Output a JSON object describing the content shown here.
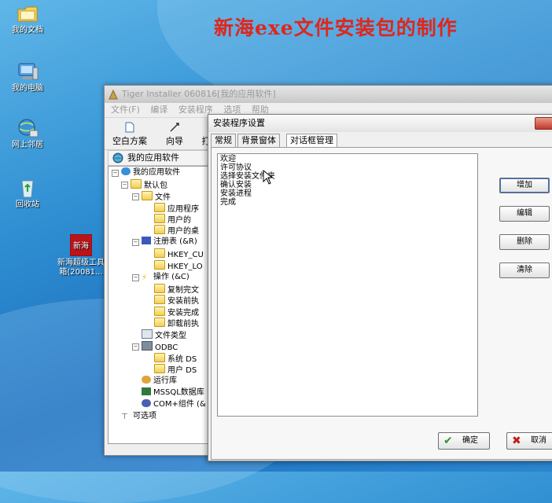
{
  "banner": {
    "title": "新海exe文件安装包的制作"
  },
  "desktop": {
    "icons": [
      {
        "label": "我的文档"
      },
      {
        "label": "我的电脑"
      },
      {
        "label": "网上邻居"
      },
      {
        "label": "回收站"
      },
      {
        "label_line1": "新海超级工具",
        "label_line2": "箱(20081..."
      }
    ]
  },
  "app": {
    "title": "Tiger Installer  060816[我的应用软件]",
    "menu": [
      "文件(F)",
      "编译",
      "安装程序",
      "选项",
      "帮助"
    ],
    "toolbar": [
      "空白方案",
      "向导",
      "打"
    ],
    "panel_title": "我的应用软件",
    "tree": [
      {
        "label": "我的应用软件"
      },
      {
        "label": "默认包"
      },
      {
        "label": "文件"
      },
      {
        "label": "应用程序"
      },
      {
        "label": "用户的 "
      },
      {
        "label": "用户的桌"
      },
      {
        "label": "注册表 (&R)"
      },
      {
        "label": "HKEY_CU"
      },
      {
        "label": "HKEY_LO"
      },
      {
        "label": "操作 (&C)"
      },
      {
        "label": "复制完文"
      },
      {
        "label": "安装前执"
      },
      {
        "label": "安装完成"
      },
      {
        "label": "卸载前执"
      },
      {
        "label": "文件类型"
      },
      {
        "label": "ODBC"
      },
      {
        "label": "系统 DS"
      },
      {
        "label": "用户 DS"
      },
      {
        "label": "运行库"
      },
      {
        "label": "MSSQL数据库"
      },
      {
        "label": "COM+组件 (&"
      },
      {
        "label": "可选项"
      }
    ]
  },
  "dialog": {
    "title": "安装程序设置",
    "tabs": [
      "常规",
      "背景窗体",
      "对话框管理"
    ],
    "active_tab": "对话框管理",
    "list_items": [
      "欢迎",
      "许可协议",
      "选择安装文件夹",
      "确认安装",
      "安装进程",
      "完成"
    ],
    "buttons": {
      "add": "增加",
      "edit": "编辑",
      "delete": "删除",
      "clear": "清除"
    },
    "ok": "确定",
    "cancel": "取消"
  },
  "colors": {
    "banner": "#e0261c",
    "desktop": "#2f8fd2",
    "ok_check": "#2a9a2a",
    "cancel_x": "#c0201a"
  }
}
